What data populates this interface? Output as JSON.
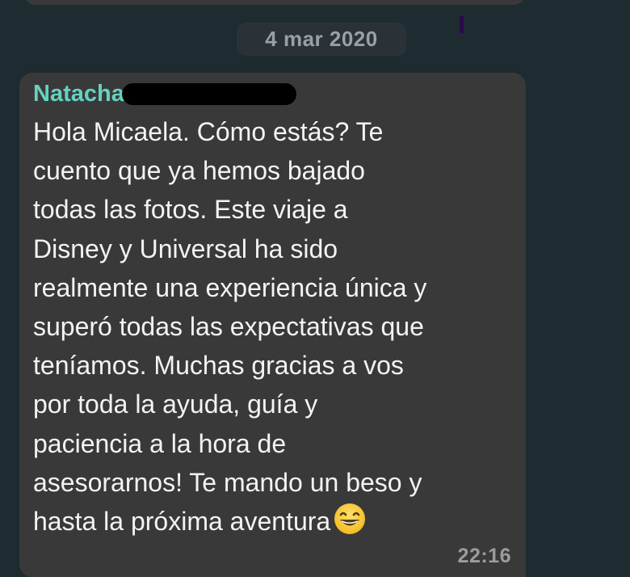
{
  "chat": {
    "date_separator": "4 mar 2020",
    "message": {
      "sender": "Natacha",
      "text": "Hola Micaela. Cómo estás? Te\ncuento que ya hemos bajado\ntodas las fotos. Este viaje a\nDisney y Universal ha sido\nrealmente una experiencia única y\nsuperó todas las expectativas que\nteníamos. Muchas gracias a vos\npor toda la ayuda, guía y\npaciencia a la hora de\nasesorarnos! Te mando un beso y\nhasta la próxima aventura",
      "emoji_icon": "grinning-face-icon",
      "time": "22:16"
    }
  },
  "colors": {
    "background": "#1e2b31",
    "bubble": "#393939",
    "sender_name": "#66d1c1",
    "message_text": "#f3f3f3",
    "timestamp": "#9c9c9c",
    "date_chip": "#2b3237"
  }
}
